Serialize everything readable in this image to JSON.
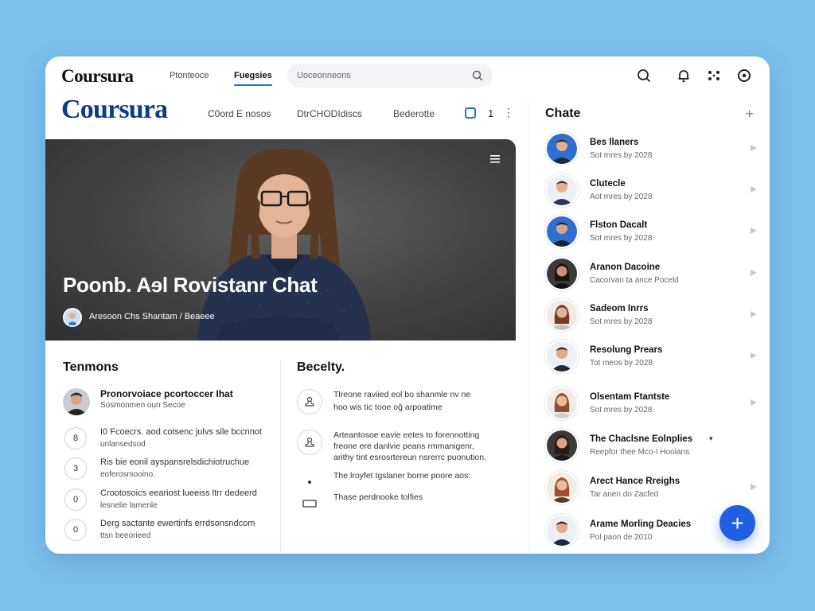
{
  "topbar": {
    "brand": "Coursura",
    "nav": [
      "Ptonteoce",
      "Fuegsies"
    ],
    "search_placeholder": "Uoceonneons"
  },
  "header": {
    "brand": "Coursura",
    "subnav": [
      "C0ord E nosos",
      "DtrCHODIdiscs",
      "Bederotte"
    ],
    "page_number": "1"
  },
  "hero": {
    "title": "Poonb. Aɘl Rovistanr Chat",
    "author": "Aresoon Chs Shantam / Beaeee"
  },
  "left_panel": {
    "title": "Tenmons",
    "featured": {
      "title": "Pronorvoiace pcortoccer Ihat",
      "subtitle": "Sosmonmen oụn Secoe"
    },
    "items": [
      {
        "badge": "8",
        "line1": "I0 Fcoecrs. aod cotsenc julvs sile bccnnot",
        "line2": "unlansedsod"
      },
      {
        "badge": "3",
        "line1": "Ris bie eonil ayspansrelsdichiotruchue",
        "line2": "eoferosrsooino."
      },
      {
        "badge": "0",
        "line1": "Crootosoics eeariost lueeiss ltrr dedeerd",
        "line2": "lesnelie lamenle"
      },
      {
        "badge": "0",
        "line1": "Derg sactante ewertinfs errdsonsndcom",
        "line2": "ttsn beeorieed"
      }
    ]
  },
  "right_panel": {
    "title": "Becelty.",
    "items": [
      {
        "lines": [
          "Tlreone raviied eol bo shanmle nv ne",
          "hoo wis tic tooe oğ arpoatime"
        ]
      },
      {
        "lines": [
          "Arteantosoe eavie eetes to forennotting",
          "freone ere danlvie peans rmmanigenr,",
          "arithy tint esrosrtereun nsrerrc puonution."
        ]
      },
      {
        "lines": [
          "The lroyfet tgslaner borne poore aos:"
        ]
      },
      {
        "lines": [
          "Thase perdnooke tolfies"
        ]
      }
    ]
  },
  "chat": {
    "title": "Chate",
    "items": [
      {
        "name": "Bes llaners",
        "sub": "Sot mres by 2028"
      },
      {
        "name": "Clutecle",
        "sub": "Aot mres by 2028"
      },
      {
        "name": "Flston Dacalt",
        "sub": "Sot mres by 2028"
      },
      {
        "name": "Aranon Dacoine",
        "sub": "Cacorvan ta ance Poceld"
      },
      {
        "name": "Sadeom Inrrs",
        "sub": "Sot mres by 2028"
      },
      {
        "name": "Resolung Prears",
        "sub": "Tot meos by 2028"
      },
      {
        "name": "Olsentam Ftantste",
        "sub": "Sot mres by 2028"
      },
      {
        "name": "The Chaclsne Eolnplies",
        "sub": "Reepfor thee Mco-I Hoolans"
      },
      {
        "name": "Arect Hance Rreighs",
        "sub": "Tar anen do Zacfed"
      },
      {
        "name": "Arame Morling Deacies",
        "sub": "Pol paon de 2010"
      }
    ]
  },
  "fab_label": "+",
  "colors": {
    "accent": "#1f5fe0",
    "brand": "#0f3a8a",
    "background": "#7cc0ee"
  }
}
